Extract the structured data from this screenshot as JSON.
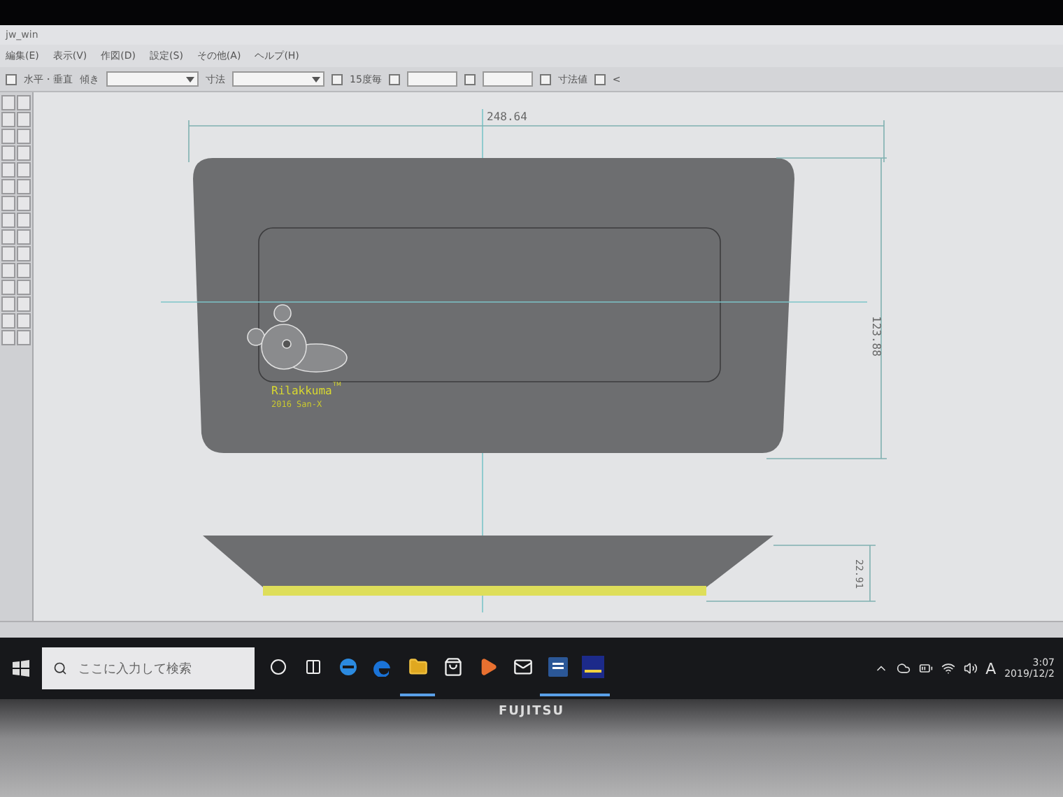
{
  "window": {
    "title": "jw_win"
  },
  "menu": [
    {
      "label": "編集(E)"
    },
    {
      "label": "表示(V)"
    },
    {
      "label": "作図(D)"
    },
    {
      "label": "設定(S)"
    },
    {
      "label": "その他(A)"
    },
    {
      "label": "ヘルプ(H)"
    }
  ],
  "toolbar": [
    {
      "kind": "checkbox",
      "label": "水平・垂直",
      "checked": false
    },
    {
      "kind": "dropdown",
      "label": "傾き"
    },
    {
      "kind": "dropdown",
      "label": "寸法"
    },
    {
      "kind": "checkbox",
      "label": "15度毎",
      "checked": false
    },
    {
      "kind": "field",
      "checked": false
    },
    {
      "kind": "field",
      "checked": false
    },
    {
      "kind": "checkbox",
      "label": "寸法値",
      "checked": false
    },
    {
      "kind": "checkbox",
      "label": "<",
      "checked": false
    }
  ],
  "drawing": {
    "width_dimension": "248.64",
    "height_dimension": "123.88",
    "side_dimension": "22.91",
    "logo_text": "Rilakkuma",
    "logo_mark": "TM",
    "copyright": "2016 San-X"
  },
  "taskbar": {
    "search": {
      "placeholder": "ここに入力して検索"
    },
    "apps": [
      {
        "kind": "cortana",
        "active": false
      },
      {
        "kind": "taskview",
        "active": false
      },
      {
        "kind": "ie",
        "active": false
      },
      {
        "kind": "edge",
        "active": false
      },
      {
        "kind": "explorer",
        "active": true
      },
      {
        "kind": "store",
        "active": false
      },
      {
        "kind": "media",
        "active": false
      },
      {
        "kind": "mail",
        "active": false
      },
      {
        "kind": "word",
        "active": true
      },
      {
        "kind": "jw",
        "active": true
      }
    ],
    "ime": "A",
    "time": "3:07",
    "date": "2019/12/2"
  },
  "bezel": {
    "brand": "FUJITSU"
  }
}
